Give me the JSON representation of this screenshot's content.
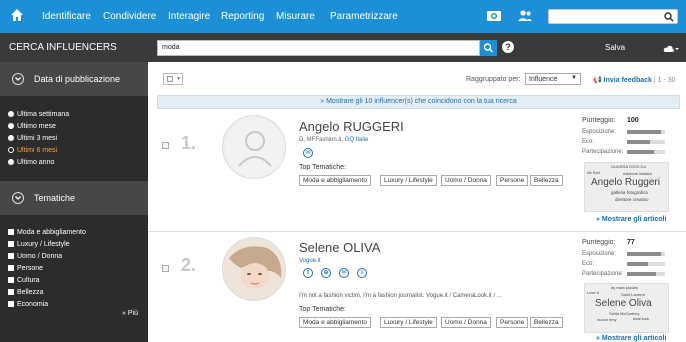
{
  "topnav": {
    "items": [
      "Identificare",
      "Condividere",
      "Interagire",
      "Reporting",
      "Misurare",
      "Parametrizzare"
    ],
    "search_value": ""
  },
  "subbar": {
    "title": "CERCA INFLUENCERS",
    "search_value": "moda",
    "help": "?",
    "save_label": "Salva"
  },
  "sidebar": {
    "pub_title": "Data di pubblicazione",
    "pub_options": [
      {
        "label": "Ultima settimana",
        "selected": false
      },
      {
        "label": "Ultimo mese",
        "selected": false
      },
      {
        "label": "Ultimi 3 mesi",
        "selected": false
      },
      {
        "label": "Ultimi 6 mesi",
        "selected": true
      },
      {
        "label": "Ultimo anno",
        "selected": false
      }
    ],
    "topics_title": "Tematiche",
    "topics": [
      "Moda e abbigliamento",
      "Luxury / Lifestyle",
      "Uomo / Donna",
      "Persone",
      "Cultura",
      "Bellezza",
      "Economia"
    ],
    "more_label": "Più"
  },
  "toolbar": {
    "grouped_by_label": "Raggruppato per:",
    "grouped_by_value": "Influence",
    "feedback_label": "Invia feedback",
    "pages": "| 1 - 30",
    "show_all": "Mostrare gli 10 influencer(s) che coincidono con la tua ricerca"
  },
  "results": [
    {
      "rank": "1.",
      "name": "Angelo RUGGERI",
      "meta_plain": "D, MFFashion.it, ",
      "meta_link": "GQ Italie",
      "bio": "",
      "top_label": "Top Tematiche:",
      "tags": [
        "Moda e abbigliamento",
        "Luxury / Lifestyle",
        "Uomo / Donna",
        "Persone",
        "Bellezza"
      ],
      "score_label": "Punteggio:",
      "score": "100",
      "metrics": [
        {
          "label": "Esposizione:",
          "value": 0.9
        },
        {
          "label": "Eco:",
          "value": 0.6
        },
        {
          "label": "Partecipazione:",
          "value": 0.7
        }
      ],
      "cloud_words": [
        "GUARDA OGGI DU",
        "Alt Roll",
        "edizione limitata",
        "Angelo Ruggeri",
        "galleria fotografica",
        "direttore creativo"
      ],
      "more_label": "Mostrare gli articoli"
    },
    {
      "rank": "2.",
      "name": "Selene OLIVA",
      "meta_plain": "",
      "meta_link": "Vogue.it",
      "bio": "I'm not a fashion victim. I'm a fashion journalist. Vogue.it / CameraLook.it / ...",
      "top_label": "Top Tematiche:",
      "tags": [
        "Moda e abbigliamento",
        "Luxury / Lifestyle",
        "Uomo / Donna",
        "Persone",
        "Bellezza"
      ],
      "score_label": "Punteggio:",
      "score": "77",
      "metrics": [
        {
          "label": "Esposizione:",
          "value": 0.9
        },
        {
          "label": "Eco:",
          "value": 0.55
        },
        {
          "label": "Partecipazione:",
          "value": 0.75
        }
      ],
      "cloud_words": [
        "by marc jacobs",
        "Love it",
        "Saint Laurent",
        "Selene Oliva",
        "Stella McCartney",
        "nuova emy",
        "total look"
      ],
      "more_label": "Mostrare gli articoli"
    }
  ]
}
